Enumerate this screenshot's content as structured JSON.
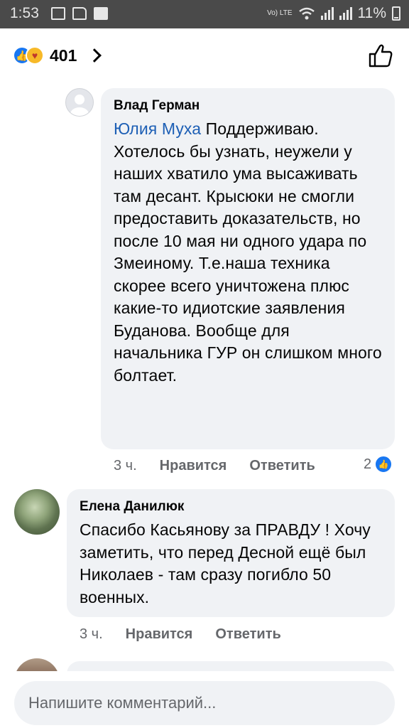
{
  "status_bar": {
    "time": "1:53",
    "network_label": "Vo) LTE",
    "battery": "11%"
  },
  "reactions": {
    "count": "401"
  },
  "comments": [
    {
      "author": "Влад Герман",
      "mention": "Юлия Муха",
      "text": "Поддерживаю. Хотелось бы узнать, неужели у наших хватило ума высаживать там десант. Крысюки не смогли предоставить доказательств, но после 10 мая ни одного удара по Змеиному. Т.е.наша техника скорее всего уничтожена плюс какие-то идиотские заявления Буданова. Вообще для начальника ГУР он слишком много болтает.",
      "time": "3 ч.",
      "like_label": "Нравится",
      "reply_label": "Ответить",
      "reaction_count": "2"
    },
    {
      "author": "Елена Данилюк",
      "text": "Спасибо Касьянову за ПРАВДУ ! Хочу заметить, что перед Десной ещё был Николаев - там сразу погибло 50 военных.",
      "time": "3 ч.",
      "like_label": "Нравится",
      "reply_label": "Ответить"
    }
  ],
  "composer": {
    "placeholder": "Напишите комментарий..."
  },
  "colors": {
    "accent": "#1877f2",
    "mention": "#1d5fb5",
    "bubble": "#f0f2f5",
    "muted": "#65676b"
  }
}
